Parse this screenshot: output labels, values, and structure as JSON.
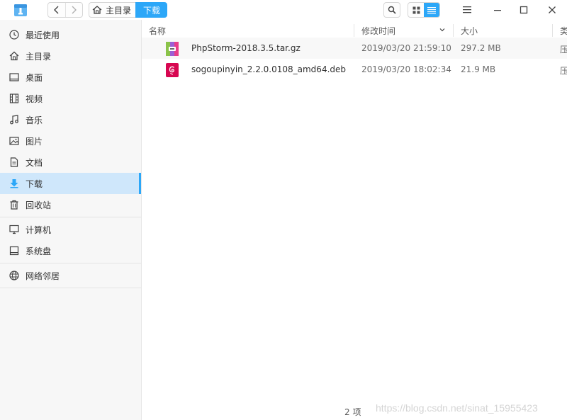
{
  "app": {
    "icon": "file-manager-icon"
  },
  "toolbar": {
    "back": "‹",
    "forward": "›",
    "breadcrumbs": [
      {
        "label": "主目录",
        "icon": "home-icon"
      },
      {
        "label": "下载"
      }
    ]
  },
  "sidebar": {
    "items": [
      {
        "label": "最近使用",
        "icon": "clock-icon"
      },
      {
        "label": "主目录",
        "icon": "home-icon"
      },
      {
        "label": "桌面",
        "icon": "desktop-icon"
      },
      {
        "label": "视频",
        "icon": "film-icon"
      },
      {
        "label": "音乐",
        "icon": "music-icon"
      },
      {
        "label": "图片",
        "icon": "picture-icon"
      },
      {
        "label": "文档",
        "icon": "document-icon"
      },
      {
        "label": "下载",
        "icon": "download-icon",
        "active": true
      },
      {
        "label": "回收站",
        "icon": "trash-icon"
      },
      {
        "label": "计算机",
        "icon": "computer-icon"
      },
      {
        "label": "系统盘",
        "icon": "disk-icon"
      },
      {
        "label": "网络邻居",
        "icon": "network-icon"
      }
    ]
  },
  "columns": [
    "名称",
    "修改时间",
    "大小",
    "类"
  ],
  "files": [
    {
      "name": "PhpStorm-2018.3.5.tar.gz",
      "modified": "2019/03/20 21:59:10",
      "size": "297.2 MB",
      "type": "压",
      "icon": "archive-icon"
    },
    {
      "name": "sogoupinyin_2.2.0.0108_amd64.deb",
      "modified": "2019/03/20 18:02:34",
      "size": "21.9 MB",
      "type": "压",
      "icon": "debian-package-icon"
    }
  ],
  "status": {
    "count": "2 项"
  },
  "watermark": "https://blog.csdn.net/sinat_15955423",
  "colors": {
    "accent": "#2ca7f8",
    "sidebar_bg": "#f7f7f7",
    "active_bg": "#cfe7fb"
  }
}
